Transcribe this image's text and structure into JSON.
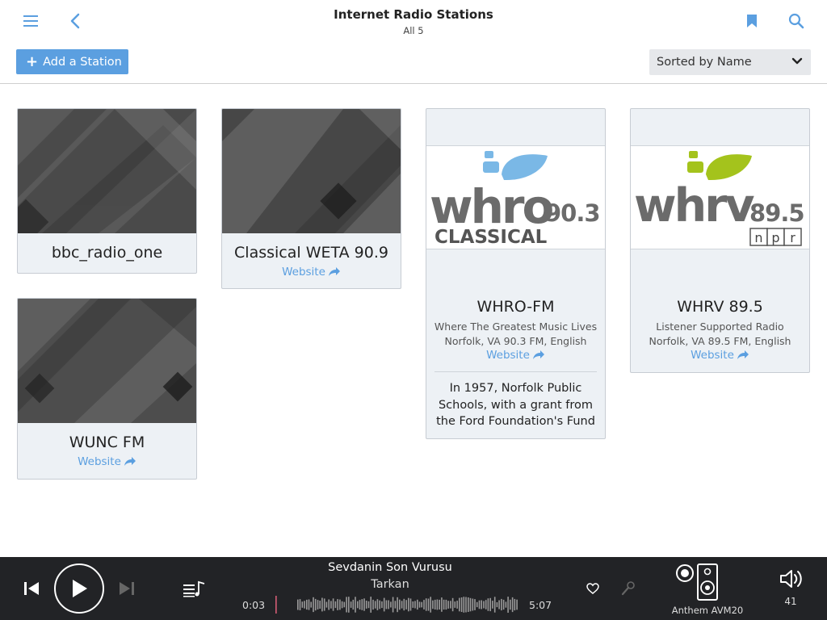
{
  "header": {
    "title": "Internet Radio Stations",
    "subtitle": "All 5",
    "add_label": "Add a Station",
    "sort_label": "Sorted by Name",
    "icons": [
      "menu-icon",
      "back-icon",
      "bookmark-icon",
      "search-icon"
    ]
  },
  "stations": [
    {
      "name": "bbc_radio_one"
    },
    {
      "name": "Classical WETA 90.9",
      "link": "Website"
    },
    {
      "name": "WHRO-FM",
      "logo_text": "whro",
      "logo_freq": "90.3",
      "logo_sub": "CLASSICAL",
      "tagline": "Where The Greatest Music Lives",
      "location": "Norfolk, VA 90.3 FM, English",
      "link": "Website",
      "description": [
        "In 1957, Norfolk Public",
        "Schools, with a grant from",
        "the Ford Foundation's Fund"
      ]
    },
    {
      "name": "WHRV 89.5",
      "logo_text": "whrv",
      "logo_freq": "89.5",
      "logo_sub": [
        "n",
        "p",
        "r"
      ],
      "tagline": "Listener Supported Radio",
      "location": "Norfolk, VA 89.5 FM, English",
      "link": "Website"
    },
    {
      "name": "WUNC FM",
      "link": "Website"
    }
  ],
  "player": {
    "song": "Sevdanin Son Vurusu",
    "artist": "Tarkan",
    "elapsed": "0:03",
    "duration": "5:07",
    "progress": 0.01,
    "device": "Anthem AVM20",
    "volume": "41"
  },
  "colors": {
    "accent": "#5b9fe0",
    "whro_leaf": "#7ab8e6",
    "whrv_leaf": "#a4c31c",
    "logo_gray": "#6b6b6b",
    "player_bg": "#222326"
  }
}
